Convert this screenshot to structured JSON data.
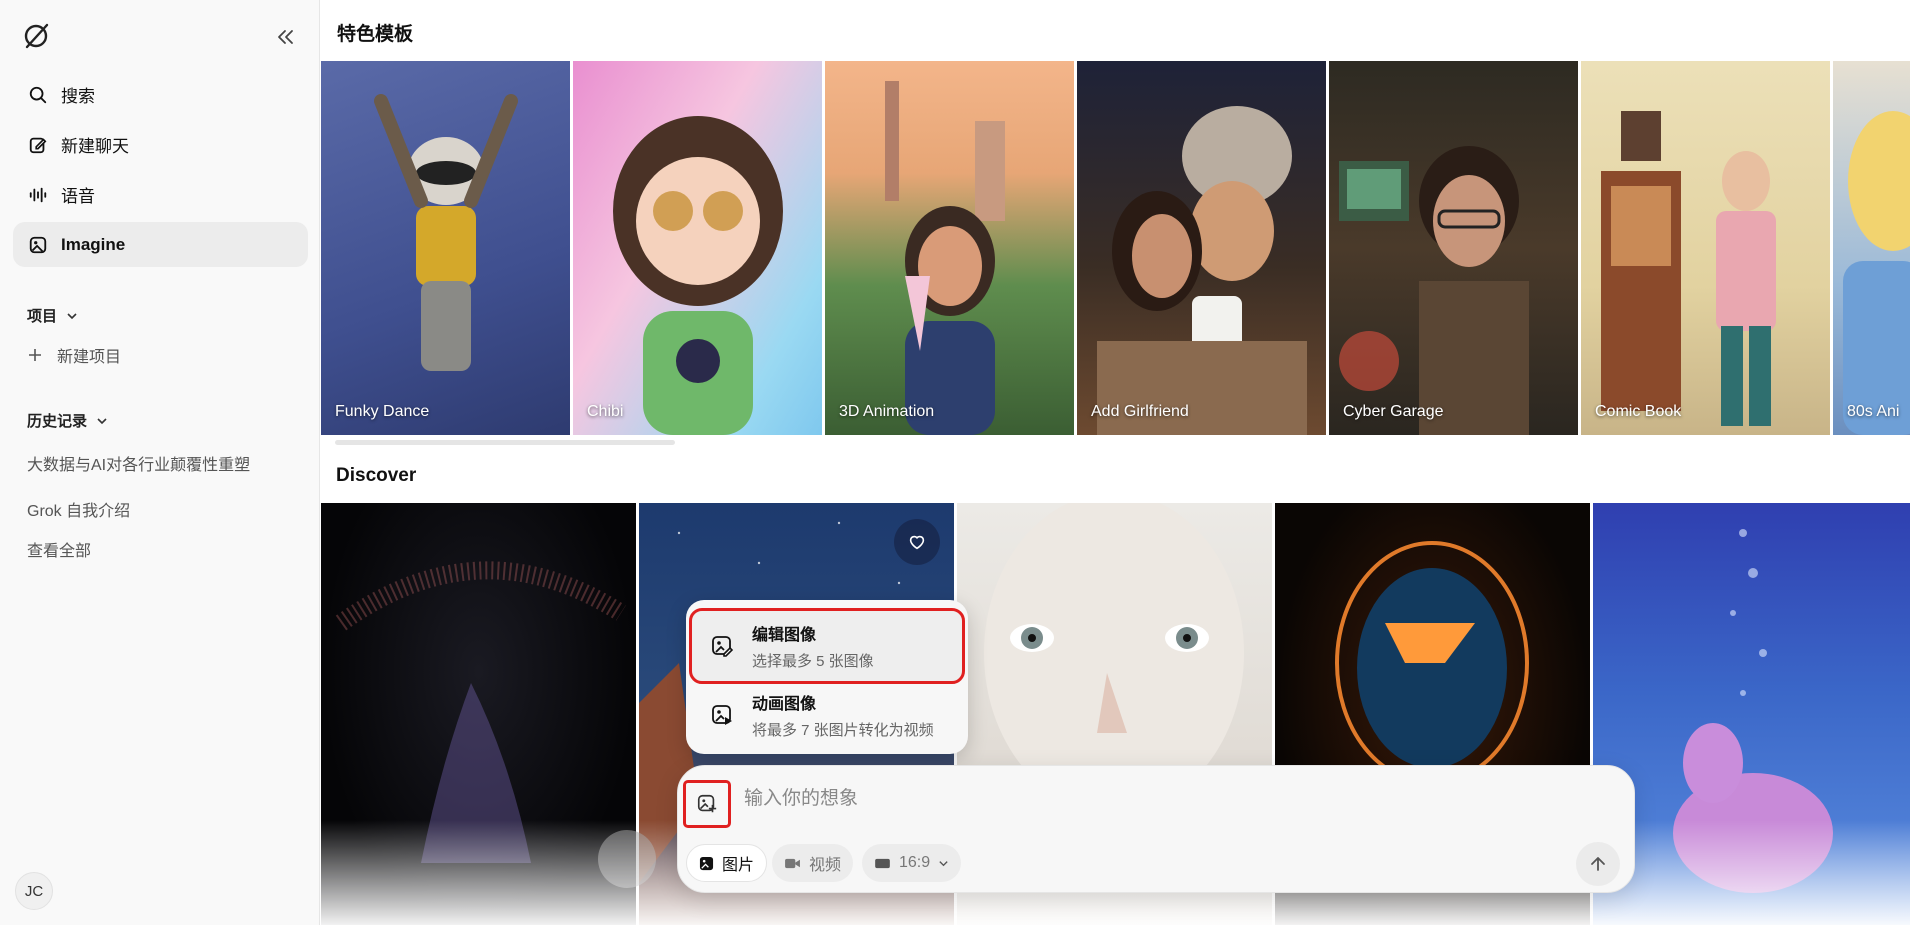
{
  "sidebar": {
    "nav": [
      {
        "label": "搜索",
        "icon": "search-icon"
      },
      {
        "label": "新建聊天",
        "icon": "edit-icon"
      },
      {
        "label": "语音",
        "icon": "voice-waveform-icon"
      },
      {
        "label": "Imagine",
        "icon": "imagine-icon",
        "active": true
      }
    ],
    "projects_label": "项目",
    "new_project_label": "新建项目",
    "history_label": "历史记录",
    "history_items": [
      "大数据与AI对各行业颠覆性重塑",
      "Grok 自我介绍"
    ],
    "view_all_label": "查看全部",
    "avatar_initials": "JC"
  },
  "main": {
    "templates_title": "特色模板",
    "templates": [
      {
        "label": "Funky Dance"
      },
      {
        "label": "Chibi"
      },
      {
        "label": "3D Animation"
      },
      {
        "label": "Add Girlfriend"
      },
      {
        "label": "Cyber Garage"
      },
      {
        "label": "Comic Book"
      },
      {
        "label": "80s Ani"
      }
    ],
    "discover_title": "Discover"
  },
  "menu": {
    "items": [
      {
        "title": "编辑图像",
        "subtitle": "选择最多 5 张图像",
        "icon": "image-edit-icon"
      },
      {
        "title": "动画图像",
        "subtitle": "将最多 7 张图片转化为视频",
        "icon": "image-animate-icon"
      }
    ]
  },
  "composer": {
    "placeholder": "输入你的想象",
    "mode_image": "图片",
    "mode_video": "视频",
    "aspect_ratio": "16:9"
  },
  "colors": {
    "highlight": "#e02020",
    "active_bg": "#ececec"
  }
}
